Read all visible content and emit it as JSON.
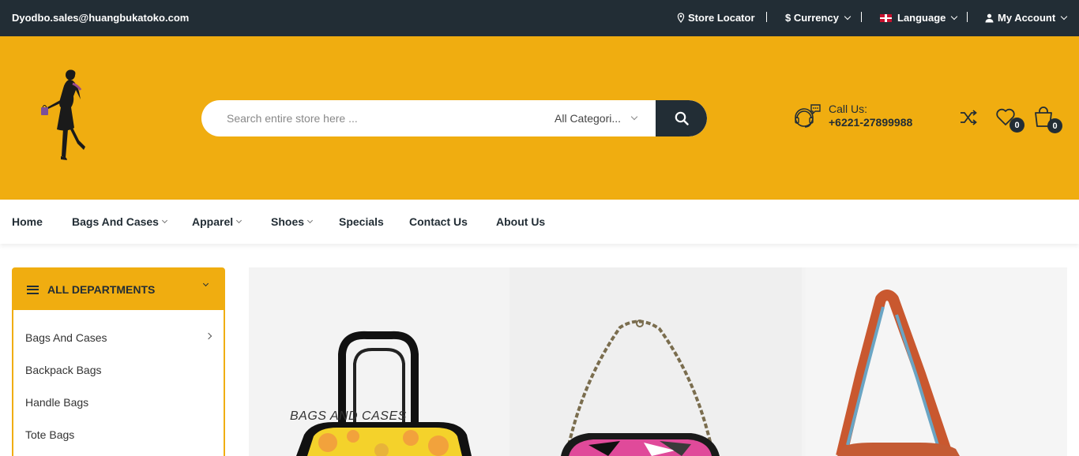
{
  "topbar": {
    "email": "Dyodbo.sales@huangbukatoko.com",
    "store_locator": "Store Locator",
    "currency": "$ Currency",
    "language": "Language",
    "account": "My Account"
  },
  "header": {
    "search_placeholder": "Search entire store here ...",
    "category_select": "All Categori...",
    "call_label": "Call Us:",
    "phone": "+6221-27899988",
    "wishlist_count": "0",
    "cart_count": "0"
  },
  "nav": {
    "items": [
      {
        "label": "Home"
      },
      {
        "label": "Bags And Cases"
      },
      {
        "label": "Apparel"
      },
      {
        "label": "Shoes"
      },
      {
        "label": "Specials"
      },
      {
        "label": "Contact Us"
      },
      {
        "label": "About Us"
      }
    ]
  },
  "sidebar": {
    "title": "ALL DEPARTMENTS",
    "items": [
      {
        "label": "Bags And Cases"
      },
      {
        "label": "Backpack Bags"
      },
      {
        "label": "Handle Bags"
      },
      {
        "label": "Tote Bags"
      }
    ]
  },
  "banner": {
    "caption": "BAGS AND CASES"
  },
  "colors": {
    "accent": "#f0ad10",
    "dark": "#222d35"
  }
}
